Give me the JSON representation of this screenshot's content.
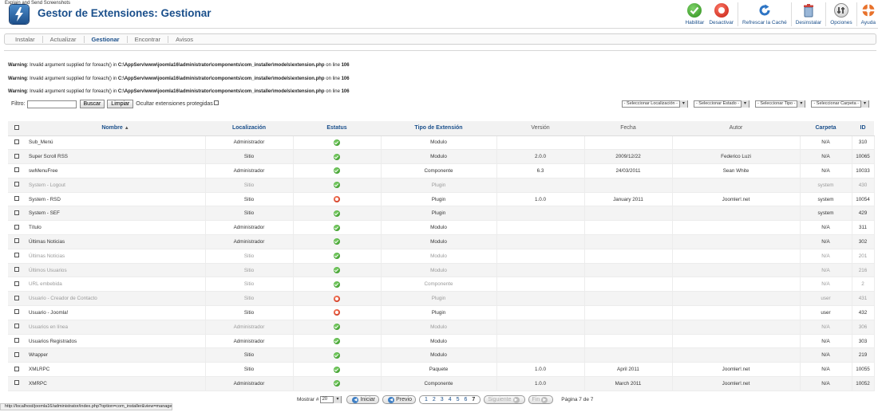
{
  "window": {
    "caption": "Explain and Send Screenshots"
  },
  "header": {
    "title": "Gestor de Extensiones: Gestionar",
    "logo_icon": "joomla-lightning-logo"
  },
  "toolbar": [
    {
      "label": "Habilitar",
      "icon": "check-circle-icon"
    },
    {
      "label": "Desactivar",
      "icon": "stop-circle-icon"
    },
    {
      "label": "Refrescar la Caché",
      "icon": "refresh-icon"
    },
    {
      "label": "Desinstalar",
      "icon": "trash-icon"
    },
    {
      "label": "Opciones",
      "icon": "options-icon"
    },
    {
      "label": "Ayuda",
      "icon": "help-lifebuoy-icon"
    }
  ],
  "tabs": [
    {
      "label": "Instalar",
      "active": false
    },
    {
      "label": "Actualizar",
      "active": false
    },
    {
      "label": "Gestionar",
      "active": true
    },
    {
      "label": "Encontrar",
      "active": false
    },
    {
      "label": "Avisos",
      "active": false
    }
  ],
  "warnings": [
    {
      "label": "Warning",
      "text": ": Invalid argument supplied for foreach() in ",
      "path": "C:\\AppServ\\www\\joomla16\\administrator\\components\\com_installer\\models\\extension.php",
      "on": " on line ",
      "line": "106"
    },
    {
      "label": "Warning",
      "text": ": Invalid argument supplied for foreach() in ",
      "path": "C:\\AppServ\\www\\joomla16\\administrator\\components\\com_installer\\models\\extension.php",
      "on": " on line ",
      "line": "106"
    },
    {
      "label": "Warning",
      "text": ": Invalid argument supplied for foreach() in ",
      "path": "C:\\AppServ\\www\\joomla16\\administrator\\components\\com_installer\\models\\extension.php",
      "on": " on line ",
      "line": "106"
    }
  ],
  "filter": {
    "label": "Filtro:",
    "value": "",
    "search_label": "Buscar",
    "clear_label": "Limpiar",
    "hide_protected_label": "Ocultar extensiones protegidas"
  },
  "selects": [
    "- Seleccionar Localización -",
    "- Seleccionar Estado -",
    "- Seleccionar Tipo -",
    "- Seleccionar Carpeta -"
  ],
  "table": {
    "columns": [
      "Nombre",
      "Localización",
      "Estatus",
      "Tipo de Extensión",
      "Versión",
      "Fecha",
      "Autor",
      "Carpeta",
      "ID"
    ],
    "rows": [
      {
        "name": "Sub_Menú",
        "location": "Administrador",
        "status": "enabled",
        "type": "Modulo",
        "version": "",
        "date": "",
        "author": "",
        "folder": "N/A",
        "id": "310",
        "muted": false
      },
      {
        "name": "Super Scroll RSS",
        "location": "Sitio",
        "status": "enabled",
        "type": "Modulo",
        "version": "2.0.0",
        "date": "2009/12/22",
        "author": "Federico Luzi",
        "folder": "N/A",
        "id": "10065",
        "muted": false
      },
      {
        "name": "swMenuFree",
        "location": "Administrador",
        "status": "enabled",
        "type": "Componente",
        "version": "6.3",
        "date": "24/03/2011",
        "author": "Sean White",
        "folder": "N/A",
        "id": "10033",
        "muted": false
      },
      {
        "name": "System - Logout",
        "location": "Sitio",
        "status": "enabled",
        "type": "Plugin",
        "version": "",
        "date": "",
        "author": "",
        "folder": "system",
        "id": "430",
        "muted": true
      },
      {
        "name": "System - RSD",
        "location": "Sitio",
        "status": "disabled",
        "type": "Plugin",
        "version": "1.0.0",
        "date": "January 2011",
        "author": "Joomler!.net",
        "folder": "system",
        "id": "10054",
        "muted": false
      },
      {
        "name": "System - SEF",
        "location": "Sitio",
        "status": "enabled",
        "type": "Plugin",
        "version": "",
        "date": "",
        "author": "",
        "folder": "system",
        "id": "429",
        "muted": false
      },
      {
        "name": "Título",
        "location": "Administrador",
        "status": "enabled",
        "type": "Modulo",
        "version": "",
        "date": "",
        "author": "",
        "folder": "N/A",
        "id": "311",
        "muted": false
      },
      {
        "name": "Últimas Noticias",
        "location": "Administrador",
        "status": "enabled",
        "type": "Modulo",
        "version": "",
        "date": "",
        "author": "",
        "folder": "N/A",
        "id": "302",
        "muted": false
      },
      {
        "name": "Últimas Noticias",
        "location": "Sitio",
        "status": "enabled",
        "type": "Modulo",
        "version": "",
        "date": "",
        "author": "",
        "folder": "N/A",
        "id": "201",
        "muted": true
      },
      {
        "name": "Últimos Usuarios",
        "location": "Sitio",
        "status": "enabled",
        "type": "Modulo",
        "version": "",
        "date": "",
        "author": "",
        "folder": "N/A",
        "id": "216",
        "muted": true
      },
      {
        "name": "URL embebida",
        "location": "Sitio",
        "status": "enabled",
        "type": "Componente",
        "version": "",
        "date": "",
        "author": "",
        "folder": "N/A",
        "id": "2",
        "muted": true
      },
      {
        "name": "Usuario - Creador de Contacto",
        "location": "Sitio",
        "status": "disabled",
        "type": "Plugin",
        "version": "",
        "date": "",
        "author": "",
        "folder": "user",
        "id": "431",
        "muted": true
      },
      {
        "name": "Usuario - Joomla!",
        "location": "Sitio",
        "status": "disabled",
        "type": "Plugin",
        "version": "",
        "date": "",
        "author": "",
        "folder": "user",
        "id": "432",
        "muted": false
      },
      {
        "name": "Usuarios en línea",
        "location": "Administrador",
        "status": "enabled",
        "type": "Modulo",
        "version": "",
        "date": "",
        "author": "",
        "folder": "N/A",
        "id": "306",
        "muted": true
      },
      {
        "name": "Usuarios Registrados",
        "location": "Administrador",
        "status": "enabled",
        "type": "Modulo",
        "version": "",
        "date": "",
        "author": "",
        "folder": "N/A",
        "id": "303",
        "muted": false
      },
      {
        "name": "Wrapper",
        "location": "Sitio",
        "status": "enabled",
        "type": "Modulo",
        "version": "",
        "date": "",
        "author": "",
        "folder": "N/A",
        "id": "219",
        "muted": false
      },
      {
        "name": "XMLRPC",
        "location": "Sitio",
        "status": "enabled",
        "type": "Paquete",
        "version": "1.0.0",
        "date": "April 2011",
        "author": "Joomler!.net",
        "folder": "N/A",
        "id": "10055",
        "muted": false
      },
      {
        "name": "XMRPC",
        "location": "Administrador",
        "status": "enabled",
        "type": "Componente",
        "version": "1.0.0",
        "date": "March 2011",
        "author": "Joomler!.net",
        "folder": "N/A",
        "id": "10052",
        "muted": false
      }
    ]
  },
  "pagination": {
    "show_label": "Mostrar #",
    "limit": "20",
    "start_label": "Iniciar",
    "prev_label": "Previo",
    "pages": [
      "1",
      "2",
      "3",
      "4",
      "5",
      "6",
      "7"
    ],
    "current_page": "7",
    "next_label": "Siguiente",
    "end_label": "Fin",
    "info": "Página 7 de 7"
  },
  "statusbar": {
    "url": "http://localhost/joomla16/administrator/index.php?option=com_installer&view=manage"
  },
  "colors": {
    "accent": "#1a4f8b",
    "enabled": "#2b8c1a",
    "disabled": "#c0200c"
  }
}
